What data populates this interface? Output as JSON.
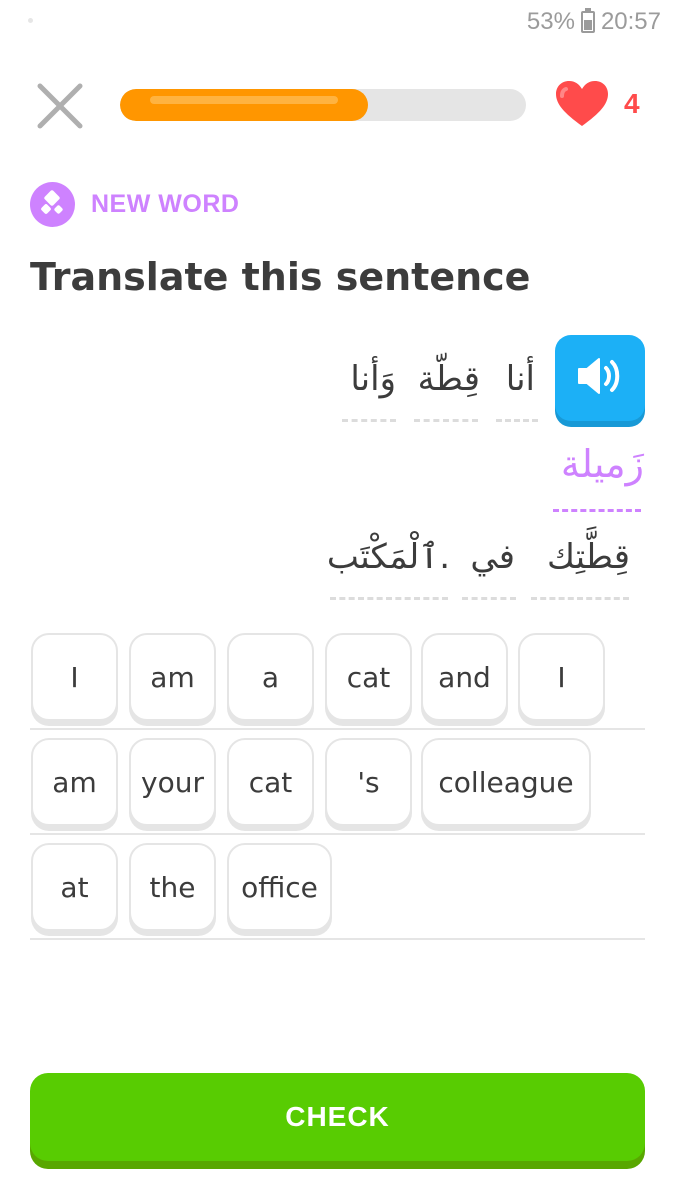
{
  "status_bar": {
    "battery": "53%",
    "time": "20:57"
  },
  "top_bar": {
    "progress_fraction": 0.61,
    "hearts": "4"
  },
  "badge": {
    "label": "NEW WORD"
  },
  "page_title": "Translate this sentence",
  "sentence": {
    "words": [
      "أنا",
      "قِطّة",
      "وَأنا",
      "زَميلة",
      "قِطَّتِك",
      "في",
      "ٱلْمَكْتَب."
    ],
    "new_word_index": 3
  },
  "word_bank": [
    "I",
    "am",
    "a",
    "cat",
    "and",
    "I",
    "am",
    "your",
    "cat",
    "'s",
    "colleague",
    "at",
    "the",
    "office"
  ],
  "check_button": {
    "label": "CHECK"
  },
  "colors": {
    "accent_orange": "#ff9600",
    "heart_red": "#ff4b4b",
    "new_word_purple": "#ce82ff",
    "speaker_blue": "#1cb0f6",
    "check_green": "#58cc02"
  }
}
